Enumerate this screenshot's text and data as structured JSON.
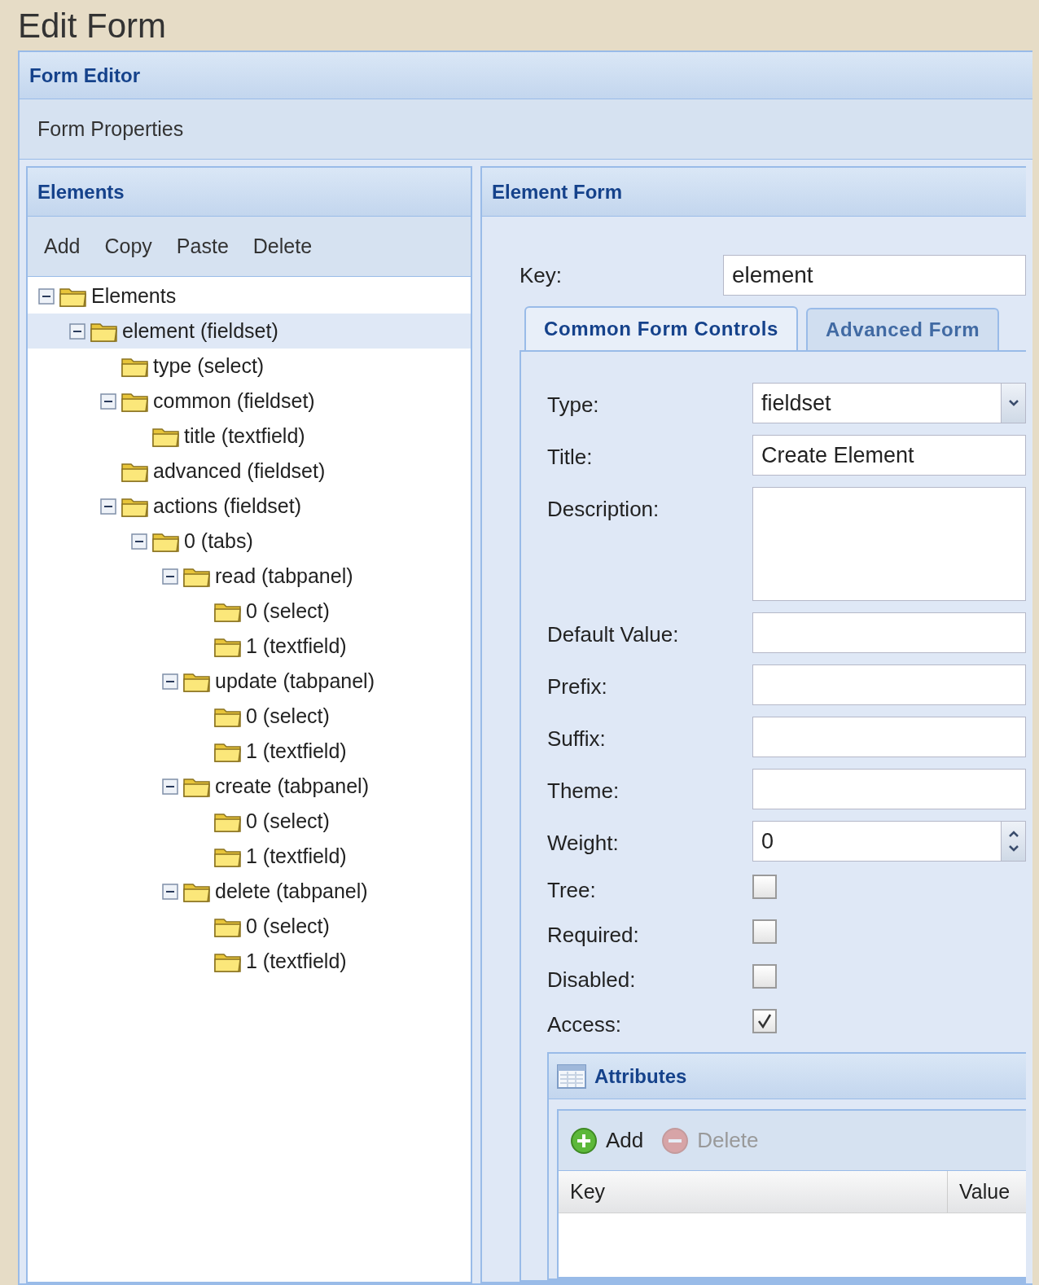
{
  "page_title": "Edit Form",
  "form_editor": {
    "title": "Form Editor",
    "toolbar": [
      "Form Properties"
    ]
  },
  "elements_panel": {
    "title": "Elements",
    "toolbar": [
      "Add",
      "Copy",
      "Paste",
      "Delete"
    ],
    "tree": [
      {
        "label": "Elements",
        "expanded": true,
        "selected": false,
        "children": [
          {
            "label": "element (fieldset)",
            "expanded": true,
            "selected": true,
            "children": [
              {
                "label": "type (select)",
                "selected": false
              },
              {
                "label": "common (fieldset)",
                "expanded": true,
                "selected": false,
                "children": [
                  {
                    "label": "title (textfield)",
                    "selected": false
                  }
                ]
              },
              {
                "label": "advanced (fieldset)",
                "selected": false
              },
              {
                "label": "actions (fieldset)",
                "expanded": true,
                "selected": false,
                "children": [
                  {
                    "label": "0 (tabs)",
                    "expanded": true,
                    "selected": false,
                    "children": [
                      {
                        "label": "read (tabpanel)",
                        "expanded": true,
                        "selected": false,
                        "children": [
                          {
                            "label": "0 (select)",
                            "selected": false
                          },
                          {
                            "label": "1 (textfield)",
                            "selected": false
                          }
                        ]
                      },
                      {
                        "label": "update (tabpanel)",
                        "expanded": true,
                        "selected": false,
                        "children": [
                          {
                            "label": "0 (select)",
                            "selected": false
                          },
                          {
                            "label": "1 (textfield)",
                            "selected": false
                          }
                        ]
                      },
                      {
                        "label": "create (tabpanel)",
                        "expanded": true,
                        "selected": false,
                        "children": [
                          {
                            "label": "0 (select)",
                            "selected": false
                          },
                          {
                            "label": "1 (textfield)",
                            "selected": false
                          }
                        ]
                      },
                      {
                        "label": "delete (tabpanel)",
                        "expanded": true,
                        "selected": false,
                        "children": [
                          {
                            "label": "0 (select)",
                            "selected": false
                          },
                          {
                            "label": "1 (textfield)",
                            "selected": false
                          }
                        ]
                      }
                    ]
                  }
                ]
              }
            ]
          }
        ]
      }
    ]
  },
  "element_form": {
    "title": "Element Form",
    "key": {
      "label": "Key:",
      "value": "element"
    },
    "tabs": [
      {
        "label": "Common Form Controls",
        "selected": true
      },
      {
        "label": "Advanced Form",
        "selected": false
      }
    ],
    "fields": [
      {
        "kind": "select",
        "label": "Type:",
        "value": "fieldset"
      },
      {
        "kind": "text",
        "label": "Title:",
        "value": "Create Element"
      },
      {
        "kind": "textarea",
        "label": "Description:"
      },
      {
        "kind": "text",
        "label": "Default Value:"
      },
      {
        "kind": "text",
        "label": "Prefix:"
      },
      {
        "kind": "text",
        "label": "Suffix:"
      },
      {
        "kind": "text",
        "label": "Theme:"
      },
      {
        "kind": "number",
        "label": "Weight:",
        "value": "0"
      },
      {
        "kind": "checkbox",
        "label": "Tree:",
        "checked": false
      },
      {
        "kind": "checkbox",
        "label": "Required:",
        "checked": false
      },
      {
        "kind": "checkbox",
        "label": "Disabled:",
        "checked": false
      },
      {
        "kind": "checkbox",
        "label": "Access:",
        "checked": true
      }
    ],
    "attributes": {
      "title": "Attributes",
      "toolbar": [
        {
          "kind": "add",
          "label": "Add",
          "disabled": false
        },
        {
          "kind": "delete",
          "label": "Delete",
          "disabled": true
        }
      ],
      "columns": [
        "Key",
        "Value"
      ]
    }
  }
}
